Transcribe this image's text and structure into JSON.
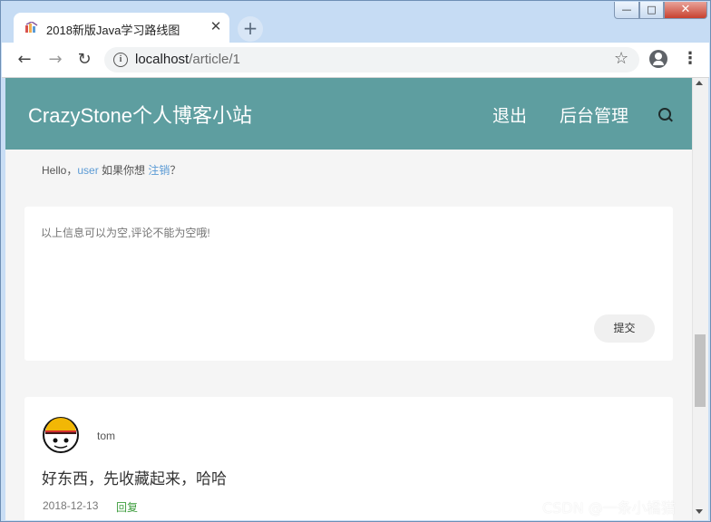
{
  "browser": {
    "tab_title": "2018新版Java学习路线图",
    "tab_close": "✕",
    "new_tab": "+",
    "url_host": "localhost",
    "url_path": "/article/1",
    "window_controls": {
      "minimize": "—",
      "maximize": "□",
      "close": "✕"
    }
  },
  "site": {
    "brand": "CrazyStone个人博客小站",
    "nav": {
      "logout": "退出",
      "admin": "后台管理"
    },
    "accent_color": "#5e9ea0"
  },
  "greeting": {
    "prefix": "Hello，",
    "user": "user",
    "middle": " 如果你想 ",
    "logout_link": "注销",
    "suffix": "？"
  },
  "comment_form": {
    "placeholder": "以上信息可以为空,评论不能为空哦!",
    "submit_label": "提交"
  },
  "comments": [
    {
      "author": "tom",
      "text": "好东西，先收藏起来，哈哈",
      "date": "2018-12-13",
      "reply_label": "回复"
    }
  ],
  "watermark": "CSDN @一条小橘猫"
}
